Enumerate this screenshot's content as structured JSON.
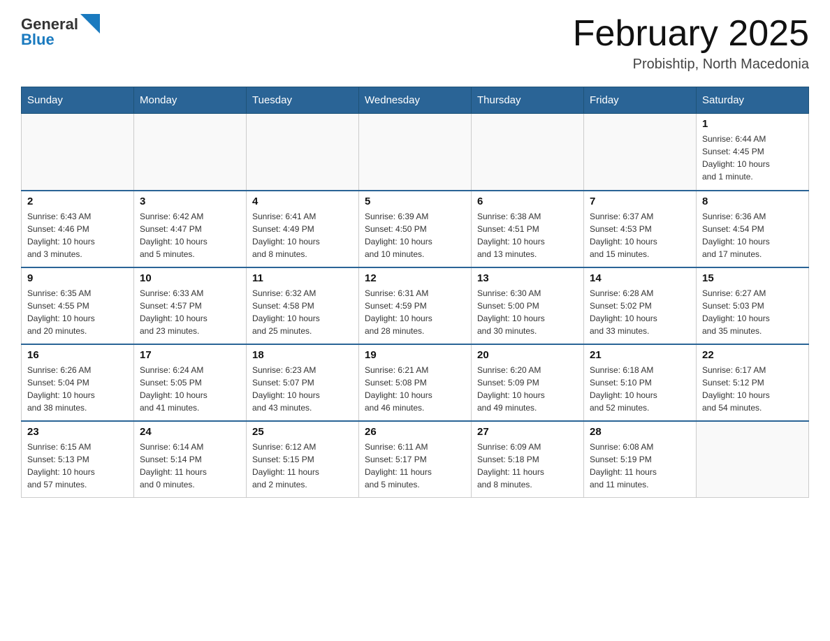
{
  "logo": {
    "general": "General",
    "blue": "Blue"
  },
  "title": "February 2025",
  "subtitle": "Probishtip, North Macedonia",
  "days_of_week": [
    "Sunday",
    "Monday",
    "Tuesday",
    "Wednesday",
    "Thursday",
    "Friday",
    "Saturday"
  ],
  "weeks": [
    [
      {
        "day": "",
        "info": ""
      },
      {
        "day": "",
        "info": ""
      },
      {
        "day": "",
        "info": ""
      },
      {
        "day": "",
        "info": ""
      },
      {
        "day": "",
        "info": ""
      },
      {
        "day": "",
        "info": ""
      },
      {
        "day": "1",
        "info": "Sunrise: 6:44 AM\nSunset: 4:45 PM\nDaylight: 10 hours\nand 1 minute."
      }
    ],
    [
      {
        "day": "2",
        "info": "Sunrise: 6:43 AM\nSunset: 4:46 PM\nDaylight: 10 hours\nand 3 minutes."
      },
      {
        "day": "3",
        "info": "Sunrise: 6:42 AM\nSunset: 4:47 PM\nDaylight: 10 hours\nand 5 minutes."
      },
      {
        "day": "4",
        "info": "Sunrise: 6:41 AM\nSunset: 4:49 PM\nDaylight: 10 hours\nand 8 minutes."
      },
      {
        "day": "5",
        "info": "Sunrise: 6:39 AM\nSunset: 4:50 PM\nDaylight: 10 hours\nand 10 minutes."
      },
      {
        "day": "6",
        "info": "Sunrise: 6:38 AM\nSunset: 4:51 PM\nDaylight: 10 hours\nand 13 minutes."
      },
      {
        "day": "7",
        "info": "Sunrise: 6:37 AM\nSunset: 4:53 PM\nDaylight: 10 hours\nand 15 minutes."
      },
      {
        "day": "8",
        "info": "Sunrise: 6:36 AM\nSunset: 4:54 PM\nDaylight: 10 hours\nand 17 minutes."
      }
    ],
    [
      {
        "day": "9",
        "info": "Sunrise: 6:35 AM\nSunset: 4:55 PM\nDaylight: 10 hours\nand 20 minutes."
      },
      {
        "day": "10",
        "info": "Sunrise: 6:33 AM\nSunset: 4:57 PM\nDaylight: 10 hours\nand 23 minutes."
      },
      {
        "day": "11",
        "info": "Sunrise: 6:32 AM\nSunset: 4:58 PM\nDaylight: 10 hours\nand 25 minutes."
      },
      {
        "day": "12",
        "info": "Sunrise: 6:31 AM\nSunset: 4:59 PM\nDaylight: 10 hours\nand 28 minutes."
      },
      {
        "day": "13",
        "info": "Sunrise: 6:30 AM\nSunset: 5:00 PM\nDaylight: 10 hours\nand 30 minutes."
      },
      {
        "day": "14",
        "info": "Sunrise: 6:28 AM\nSunset: 5:02 PM\nDaylight: 10 hours\nand 33 minutes."
      },
      {
        "day": "15",
        "info": "Sunrise: 6:27 AM\nSunset: 5:03 PM\nDaylight: 10 hours\nand 35 minutes."
      }
    ],
    [
      {
        "day": "16",
        "info": "Sunrise: 6:26 AM\nSunset: 5:04 PM\nDaylight: 10 hours\nand 38 minutes."
      },
      {
        "day": "17",
        "info": "Sunrise: 6:24 AM\nSunset: 5:05 PM\nDaylight: 10 hours\nand 41 minutes."
      },
      {
        "day": "18",
        "info": "Sunrise: 6:23 AM\nSunset: 5:07 PM\nDaylight: 10 hours\nand 43 minutes."
      },
      {
        "day": "19",
        "info": "Sunrise: 6:21 AM\nSunset: 5:08 PM\nDaylight: 10 hours\nand 46 minutes."
      },
      {
        "day": "20",
        "info": "Sunrise: 6:20 AM\nSunset: 5:09 PM\nDaylight: 10 hours\nand 49 minutes."
      },
      {
        "day": "21",
        "info": "Sunrise: 6:18 AM\nSunset: 5:10 PM\nDaylight: 10 hours\nand 52 minutes."
      },
      {
        "day": "22",
        "info": "Sunrise: 6:17 AM\nSunset: 5:12 PM\nDaylight: 10 hours\nand 54 minutes."
      }
    ],
    [
      {
        "day": "23",
        "info": "Sunrise: 6:15 AM\nSunset: 5:13 PM\nDaylight: 10 hours\nand 57 minutes."
      },
      {
        "day": "24",
        "info": "Sunrise: 6:14 AM\nSunset: 5:14 PM\nDaylight: 11 hours\nand 0 minutes."
      },
      {
        "day": "25",
        "info": "Sunrise: 6:12 AM\nSunset: 5:15 PM\nDaylight: 11 hours\nand 2 minutes."
      },
      {
        "day": "26",
        "info": "Sunrise: 6:11 AM\nSunset: 5:17 PM\nDaylight: 11 hours\nand 5 minutes."
      },
      {
        "day": "27",
        "info": "Sunrise: 6:09 AM\nSunset: 5:18 PM\nDaylight: 11 hours\nand 8 minutes."
      },
      {
        "day": "28",
        "info": "Sunrise: 6:08 AM\nSunset: 5:19 PM\nDaylight: 11 hours\nand 11 minutes."
      },
      {
        "day": "",
        "info": ""
      }
    ]
  ]
}
